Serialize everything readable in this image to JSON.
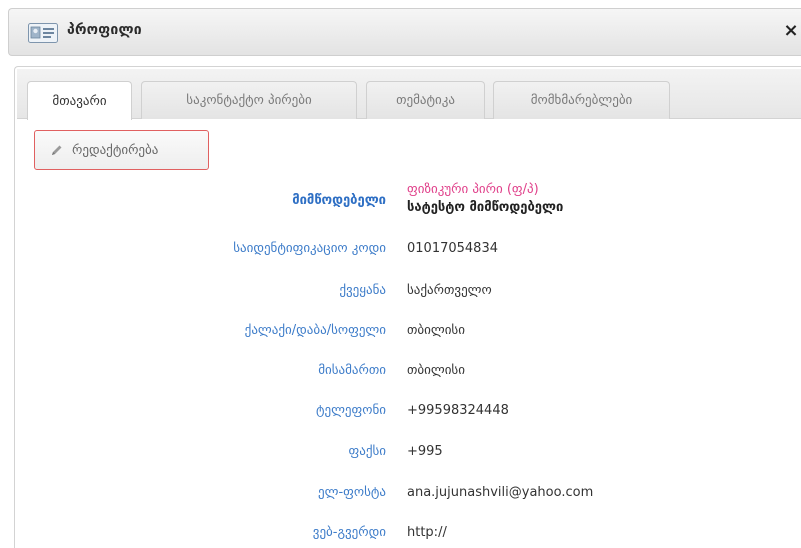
{
  "window": {
    "title": "პროფილი",
    "close_label": "×"
  },
  "tabs": [
    {
      "label": "მთავარი",
      "active": true
    },
    {
      "label": "საკონტაქტო პირები",
      "active": false
    },
    {
      "label": "თემატიკა",
      "active": false
    },
    {
      "label": "მომხმარებლები",
      "active": false
    }
  ],
  "edit_button": {
    "label": "რედაქტირება"
  },
  "supplier": {
    "label": "მიმწოდებელი",
    "type": "ფიზიკური პირი (ფ/პ)",
    "name": "სატესტო მიმწოდებელი"
  },
  "fields": [
    {
      "label": "საიდენტიფიკაციო კოდი",
      "value": "01017054834"
    },
    {
      "label": "ქვეყანა",
      "value": "საქართველო"
    },
    {
      "label": "ქალაქი/დაბა/სოფელი",
      "value": "თბილისი"
    },
    {
      "label": "მისამართი",
      "value": "თბილისი"
    },
    {
      "label": "ტელეფონი",
      "value": "+99598324448"
    },
    {
      "label": "ფაქსი",
      "value": "+995"
    },
    {
      "label": "ელ-ფოსტა",
      "value": "ana.jujunashvili@yahoo.com"
    },
    {
      "label": "ვებ-გვერდი",
      "value": "http://"
    }
  ],
  "colors": {
    "label": "#3d7cc9",
    "supplier_type": "#e0408a",
    "edit_border": "#e06060"
  }
}
